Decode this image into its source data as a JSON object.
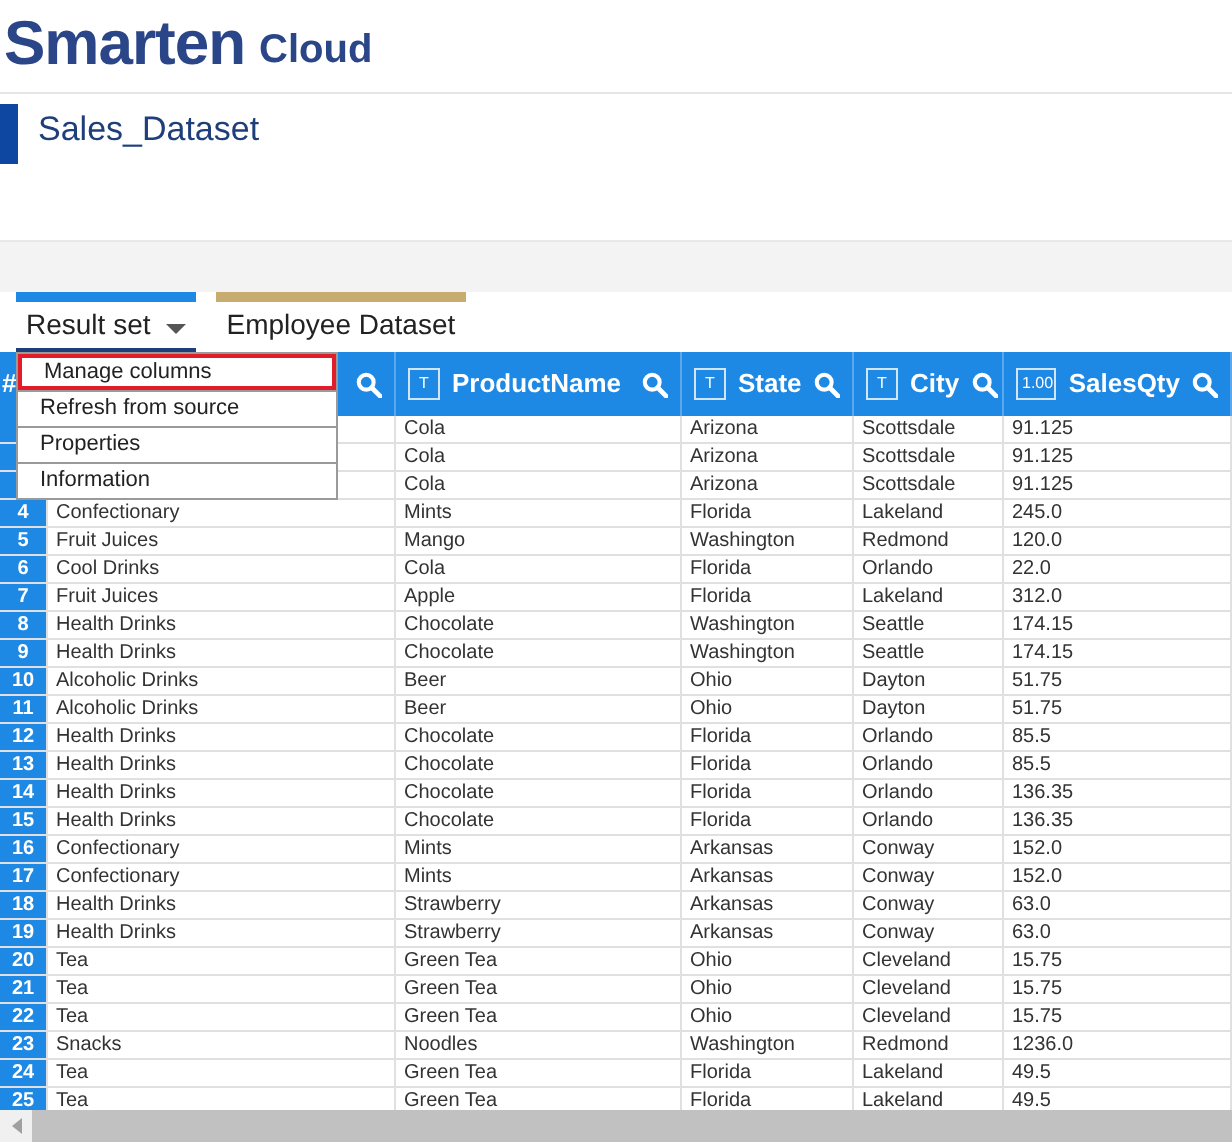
{
  "logo": {
    "name": "Smarten",
    "suffix": "Cloud"
  },
  "dataset_title": "Sales_Dataset",
  "tabs": [
    {
      "label": "Result set",
      "selected": true,
      "color": "#1e88e5",
      "has_menu": true
    },
    {
      "label": "Employee Dataset",
      "selected": false,
      "color": "#c8ab6e",
      "has_menu": false
    }
  ],
  "menu": [
    {
      "label": "Manage columns",
      "highlighted": true
    },
    {
      "label": "Refresh from source",
      "highlighted": false
    },
    {
      "label": "Properties",
      "highlighted": false
    },
    {
      "label": "Information",
      "highlighted": false
    }
  ],
  "table": {
    "columns": [
      {
        "label": "#"
      },
      {
        "search": true
      },
      {
        "type_icon": "T",
        "label": "ProductName",
        "search": true
      },
      {
        "type_icon": "T",
        "label": "State",
        "search": true
      },
      {
        "type_icon": "T",
        "label": "City",
        "search": true
      },
      {
        "type_icon": "1.00",
        "label": "SalesQty",
        "search": true
      }
    ],
    "rows": [
      {
        "cells": [
          "",
          "",
          "Cola",
          "Arizona",
          "Scottsdale",
          "91.125"
        ]
      },
      {
        "cells": [
          "",
          "",
          "Cola",
          "Arizona",
          "Scottsdale",
          "91.125"
        ]
      },
      {
        "cells": [
          "",
          "",
          "Cola",
          "Arizona",
          "Scottsdale",
          "91.125"
        ]
      },
      {
        "number": "4",
        "category": "Confectionary",
        "cells": [
          "Mints",
          "Florida",
          "Lakeland",
          "245.0"
        ]
      },
      {
        "number": "5",
        "category": "Fruit Juices",
        "cells": [
          "Mango",
          "Washington",
          "Redmond",
          "120.0"
        ]
      },
      {
        "number": "6",
        "category": "Cool Drinks",
        "cells": [
          "Cola",
          "Florida",
          "Orlando",
          "22.0"
        ]
      },
      {
        "number": "7",
        "category": "Fruit Juices",
        "cells": [
          "Apple",
          "Florida",
          "Lakeland",
          "312.0"
        ]
      },
      {
        "number": "8",
        "category": "Health Drinks",
        "cells": [
          "Chocolate",
          "Washington",
          "Seattle",
          "174.15"
        ]
      },
      {
        "number": "9",
        "category": "Health Drinks",
        "cells": [
          "Chocolate",
          "Washington",
          "Seattle",
          "174.15"
        ]
      },
      {
        "number": "10",
        "category": "Alcoholic Drinks",
        "cells": [
          "Beer",
          "Ohio",
          "Dayton",
          "51.75"
        ]
      },
      {
        "number": "11",
        "category": "Alcoholic Drinks",
        "cells": [
          "Beer",
          "Ohio",
          "Dayton",
          "51.75"
        ]
      },
      {
        "number": "12",
        "category": "Health Drinks",
        "cells": [
          "Chocolate",
          "Florida",
          "Orlando",
          "85.5"
        ]
      },
      {
        "number": "13",
        "category": "Health Drinks",
        "cells": [
          "Chocolate",
          "Florida",
          "Orlando",
          "85.5"
        ]
      },
      {
        "number": "14",
        "category": "Health Drinks",
        "cells": [
          "Chocolate",
          "Florida",
          "Orlando",
          "136.35"
        ]
      },
      {
        "number": "15",
        "category": "Health Drinks",
        "cells": [
          "Chocolate",
          "Florida",
          "Orlando",
          "136.35"
        ]
      },
      {
        "number": "16",
        "category": "Confectionary",
        "cells": [
          "Mints",
          "Arkansas",
          "Conway",
          "152.0"
        ]
      },
      {
        "number": "17",
        "category": "Confectionary",
        "cells": [
          "Mints",
          "Arkansas",
          "Conway",
          "152.0"
        ]
      },
      {
        "number": "18",
        "category": "Health Drinks",
        "cells": [
          "Strawberry",
          "Arkansas",
          "Conway",
          "63.0"
        ]
      },
      {
        "number": "19",
        "category": "Health Drinks",
        "cells": [
          "Strawberry",
          "Arkansas",
          "Conway",
          "63.0"
        ]
      },
      {
        "number": "20",
        "category": "Tea",
        "cells": [
          "Green Tea",
          "Ohio",
          "Cleveland",
          "15.75"
        ]
      },
      {
        "number": "21",
        "category": "Tea",
        "cells": [
          "Green Tea",
          "Ohio",
          "Cleveland",
          "15.75"
        ]
      },
      {
        "number": "22",
        "category": "Tea",
        "cells": [
          "Green Tea",
          "Ohio",
          "Cleveland",
          "15.75"
        ]
      },
      {
        "number": "23",
        "category": "Snacks",
        "cells": [
          "Noodles",
          "Washington",
          "Redmond",
          "1236.0"
        ]
      },
      {
        "number": "24",
        "category": "Tea",
        "cells": [
          "Green Tea",
          "Florida",
          "Lakeland",
          "49.5"
        ]
      },
      {
        "number": "25",
        "category": "Tea",
        "cells": [
          "Green Tea",
          "Florida",
          "Lakeland",
          "49.5"
        ]
      }
    ]
  }
}
